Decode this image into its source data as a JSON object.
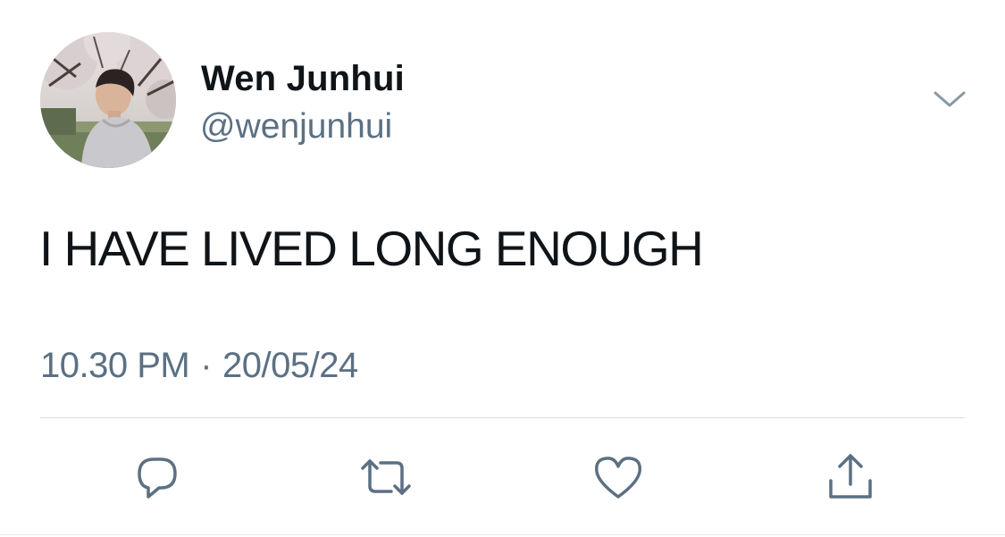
{
  "tweet": {
    "author": {
      "display_name": "Wen Junhui",
      "handle": "@wenjunhui",
      "avatar_icon": "profile-photo"
    },
    "text": "I HAVE LIVED LONG ENOUGH",
    "time": "10.30 PM",
    "separator": "·",
    "date": "20/05/24",
    "more_icon": "chevron-down-icon",
    "actions": [
      {
        "name": "reply",
        "icon": "speech-bubble-icon"
      },
      {
        "name": "retweet",
        "icon": "retweet-arrows-icon"
      },
      {
        "name": "like",
        "icon": "heart-icon"
      },
      {
        "name": "share",
        "icon": "share-upload-icon"
      }
    ]
  },
  "colors": {
    "text_primary": "#0f1419",
    "text_secondary": "#5b7083",
    "divider": "#d9dee2"
  }
}
